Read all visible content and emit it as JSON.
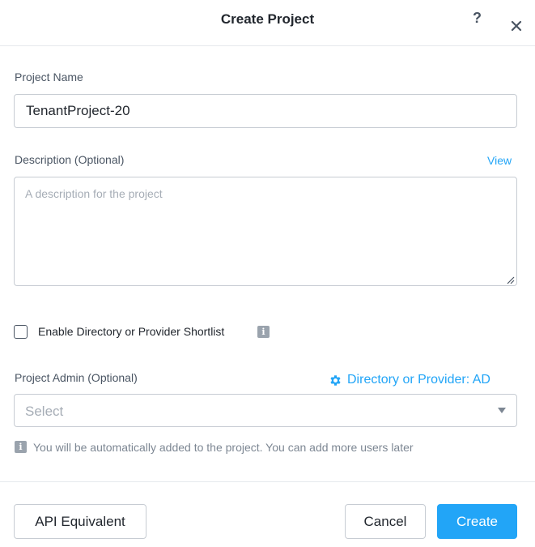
{
  "dialog": {
    "title": "Create Project",
    "help_icon": "?",
    "close_icon": "close-icon"
  },
  "form": {
    "project_name_label": "Project Name",
    "project_name_value": "TenantProject-20",
    "description_label": "Description (Optional)",
    "description_view_link": "View",
    "description_placeholder": "A description for the project",
    "description_value": "",
    "shortlist_label": "Enable Directory or Provider Shortlist",
    "shortlist_checked": false,
    "info_icon": "i",
    "project_admin_label": "Project Admin (Optional)",
    "provider_link": "Directory or Provider: AD",
    "admin_select_value": "Select",
    "hint_text": "You will be automatically added to the project. You can add more users later"
  },
  "footer": {
    "api_button": "API Equivalent",
    "cancel_button": "Cancel",
    "create_button": "Create"
  },
  "colors": {
    "accent": "#22a5f7",
    "text": "#22272e",
    "muted": "#7d8793",
    "border": "#c7ccd3"
  }
}
